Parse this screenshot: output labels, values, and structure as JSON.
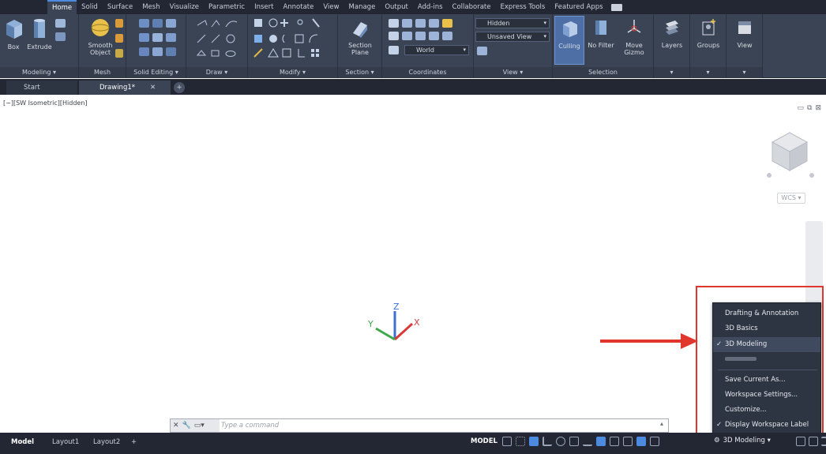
{
  "ribbon_tabs": [
    "Home",
    "Solid",
    "Surface",
    "Mesh",
    "Visualize",
    "Parametric",
    "Insert",
    "Annotate",
    "View",
    "Manage",
    "Output",
    "Add-ins",
    "Collaborate",
    "Express Tools",
    "Featured Apps"
  ],
  "active_ribbon_tab": "Home",
  "panels": {
    "modeling": {
      "title": "Modeling ▾",
      "box": "Box",
      "extrude": "Extrude"
    },
    "mesh": {
      "title": "Mesh",
      "smooth_object": "Smooth\nObject"
    },
    "solid_editing": {
      "title": "Solid Editing ▾"
    },
    "draw": {
      "title": "Draw ▾"
    },
    "modify": {
      "title": "Modify ▾"
    },
    "section": {
      "title": "Section ▾",
      "section_plane": "Section\nPlane"
    },
    "coordinates": {
      "title": "Coordinates",
      "ucs_value": "World"
    },
    "view": {
      "title": "View ▾",
      "visual_style": "Hidden",
      "saved_view": "Unsaved View"
    },
    "selection": {
      "title": "Selection",
      "culling": "Culling",
      "no_filter": "No Filter",
      "move_gizmo": "Move\nGizmo"
    },
    "layers": {
      "label": "Layers"
    },
    "groups": {
      "label": "Groups"
    },
    "view_btn": {
      "label": "View"
    }
  },
  "file_tabs": {
    "start": "Start",
    "drawing": "Drawing1*",
    "close": "✕",
    "add": "+"
  },
  "viewport": {
    "label": "[−][SW Isometric][Hidden]",
    "wcs": "WCS ▾",
    "axis_x": "X",
    "axis_y": "Y",
    "axis_z": "Z"
  },
  "workspace_menu": {
    "items": [
      {
        "label": "Drafting & Annotation",
        "checked": false
      },
      {
        "label": "3D Basics",
        "checked": false
      },
      {
        "label": "3D Modeling",
        "checked": true
      },
      {
        "label": "",
        "checked": false,
        "blurred": true
      }
    ],
    "actions": [
      "Save Current As...",
      "Workspace Settings...",
      "Customize..."
    ],
    "display_label": "Display Workspace Label",
    "display_label_checked": true
  },
  "command_line": {
    "placeholder": "Type a command"
  },
  "statusbar": {
    "layout_tabs": [
      "Model",
      "Layout1",
      "Layout2"
    ],
    "add_tab": "+",
    "model_label": "MODEL",
    "workspace": "3D Modeling ▾"
  },
  "colors": {
    "ribbon_bg": "#3b4455",
    "dark_bg": "#222733",
    "highlight_red": "#e0362e",
    "accent_blue": "#4c8be0"
  }
}
